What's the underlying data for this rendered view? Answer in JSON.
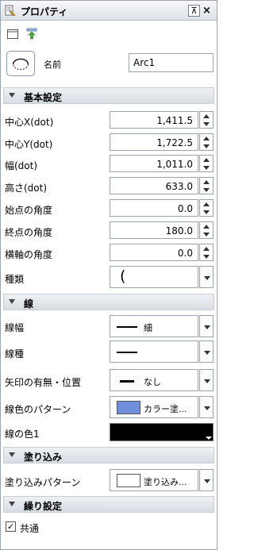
{
  "window": {
    "title": "プロパティ",
    "pin_glyph": "⊼",
    "close_glyph": "×"
  },
  "name": {
    "label": "名前",
    "value": "Arc1"
  },
  "sections": {
    "basic": "基本設定",
    "line": "線",
    "fill": "塗り込み",
    "repeat": "繰り設定"
  },
  "basic_props": [
    {
      "label": "中心X(dot)",
      "value": "1,411.5"
    },
    {
      "label": "中心Y(dot)",
      "value": "1,722.5"
    },
    {
      "label": "幅(dot)",
      "value": "1,011.0"
    },
    {
      "label": "高さ(dot)",
      "value": "633.0"
    },
    {
      "label": "始点の角度",
      "value": "0.0"
    },
    {
      "label": "終点の角度",
      "value": "180.0"
    },
    {
      "label": "横軸の角度",
      "value": "0.0"
    }
  ],
  "kind": {
    "label": "種類",
    "glyph": "("
  },
  "line_props": {
    "width": {
      "label": "線幅",
      "value": "細"
    },
    "type": {
      "label": "線種",
      "value": ""
    },
    "arrow": {
      "label": "矢印の有無・位置",
      "value": "なし"
    },
    "pattern": {
      "label": "線色のパターン",
      "value": "カラー塗..."
    },
    "color1": {
      "label": "線の色1"
    }
  },
  "fill_props": {
    "pattern": {
      "label": "塗り込みパターン",
      "value": "塗り込み..."
    }
  },
  "repeat_props": {
    "common": {
      "label": "共通",
      "check": "✓"
    }
  },
  "colors": {
    "pattern_swatch": "#6f8fdc",
    "line_color": "#000000",
    "fill_swatch": "#ffffff"
  }
}
